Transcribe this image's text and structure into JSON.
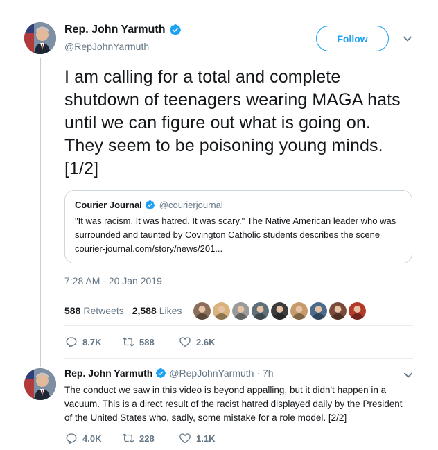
{
  "tweet": {
    "author_name": "Rep. John Yarmuth",
    "author_handle": "@RepJohnYarmuth",
    "follow_label": "Follow",
    "text": "I am calling for a total and complete shutdown of teenagers wearing MAGA hats until we can figure out what is going on. They seem to be poisoning young minds. [1/2]",
    "timestamp": "7:28 AM - 20 Jan 2019",
    "retweets_count": "588",
    "retweets_label": "Retweets",
    "likes_count": "2,588",
    "likes_label": "Likes",
    "reply_count": "8.7K",
    "retweet_count_action": "588",
    "like_count_action": "2.6K"
  },
  "quote": {
    "name": "Courier Journal",
    "handle": "@courierjournal",
    "text": "\"It was racism. It was hatred. It was scary.\" The Native American leader who was surrounded and taunted by Covington Catholic students describes the scene courier-journal.com/story/news/201..."
  },
  "reply": {
    "author_name": "Rep. John Yarmuth",
    "author_handle": "@RepJohnYarmuth",
    "time": "· 7h",
    "text": "The conduct we saw in this video is beyond appalling, but it didn't happen in a vacuum. This is a direct result of the racist hatred displayed daily by the President of the United States who, sadly, some mistake for a role model. [2/2]",
    "reply_count": "4.0K",
    "retweet_count": "228",
    "like_count": "1.1K"
  },
  "colors": {
    "accent": "#1da1f2",
    "muted": "#657786",
    "border": "#ccd6dd"
  },
  "icons": [
    "verified-badge-icon",
    "chevron-down-icon",
    "reply-icon",
    "retweet-icon",
    "like-icon"
  ],
  "likers": [
    {
      "name": "liker-1",
      "color": "#8a6d5a"
    },
    {
      "name": "liker-2",
      "color": "#d9b27c"
    },
    {
      "name": "liker-3",
      "color": "#9a9a9a"
    },
    {
      "name": "liker-4",
      "color": "#5e6f7a"
    },
    {
      "name": "liker-5",
      "color": "#3c3c3c"
    },
    {
      "name": "liker-6",
      "color": "#c79a6b"
    },
    {
      "name": "liker-7",
      "color": "#4a6b8a"
    },
    {
      "name": "liker-8",
      "color": "#7a4b3a"
    },
    {
      "name": "liker-9",
      "color": "#b33a2a"
    }
  ]
}
